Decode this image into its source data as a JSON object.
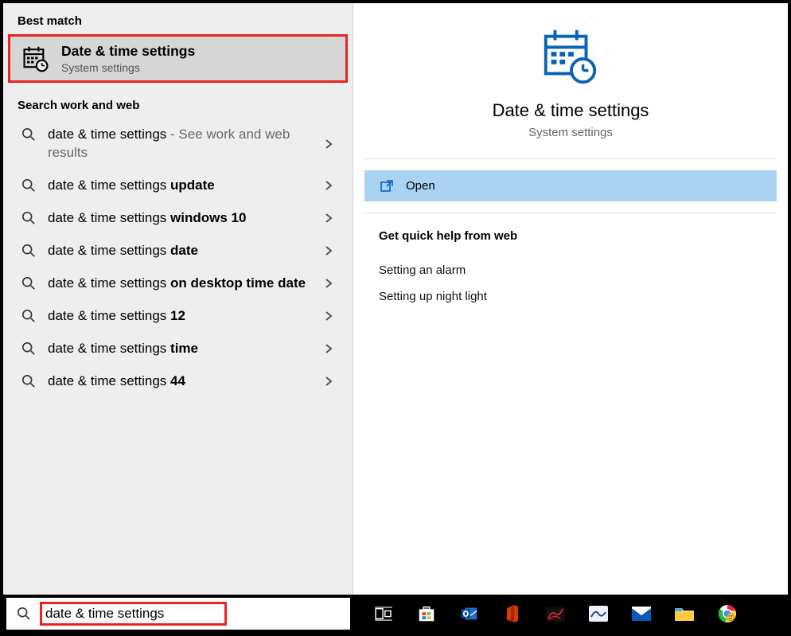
{
  "left": {
    "best_match_header": "Best match",
    "best_match": {
      "title": "Date & time settings",
      "subtitle": "System settings"
    },
    "search_section_header": "Search work and web",
    "search_items": [
      {
        "prefix": "date & time settings",
        "bold": "",
        "suffix": " - See work and web results"
      },
      {
        "prefix": "date & time settings ",
        "bold": "update",
        "suffix": ""
      },
      {
        "prefix": "date & time settings ",
        "bold": "windows 10",
        "suffix": ""
      },
      {
        "prefix": "date & time settings ",
        "bold": "date",
        "suffix": ""
      },
      {
        "prefix": "date & time settings ",
        "bold": "on desktop time date",
        "suffix": ""
      },
      {
        "prefix": "date & time settings ",
        "bold": "12",
        "suffix": ""
      },
      {
        "prefix": "date & time settings ",
        "bold": "time",
        "suffix": ""
      },
      {
        "prefix": "date & time settings ",
        "bold": "44",
        "suffix": ""
      }
    ]
  },
  "right": {
    "hero_title": "Date & time settings",
    "hero_subtitle": "System settings",
    "open_label": "Open",
    "quick_help_header": "Get quick help from web",
    "quick_help_links": [
      "Setting an alarm",
      "Setting up night light"
    ]
  },
  "taskbar": {
    "search_value": "date & time settings"
  },
  "colors": {
    "accent": "#0a63b8",
    "highlight": "#ee2222",
    "open_bg": "#a9d3f2"
  }
}
